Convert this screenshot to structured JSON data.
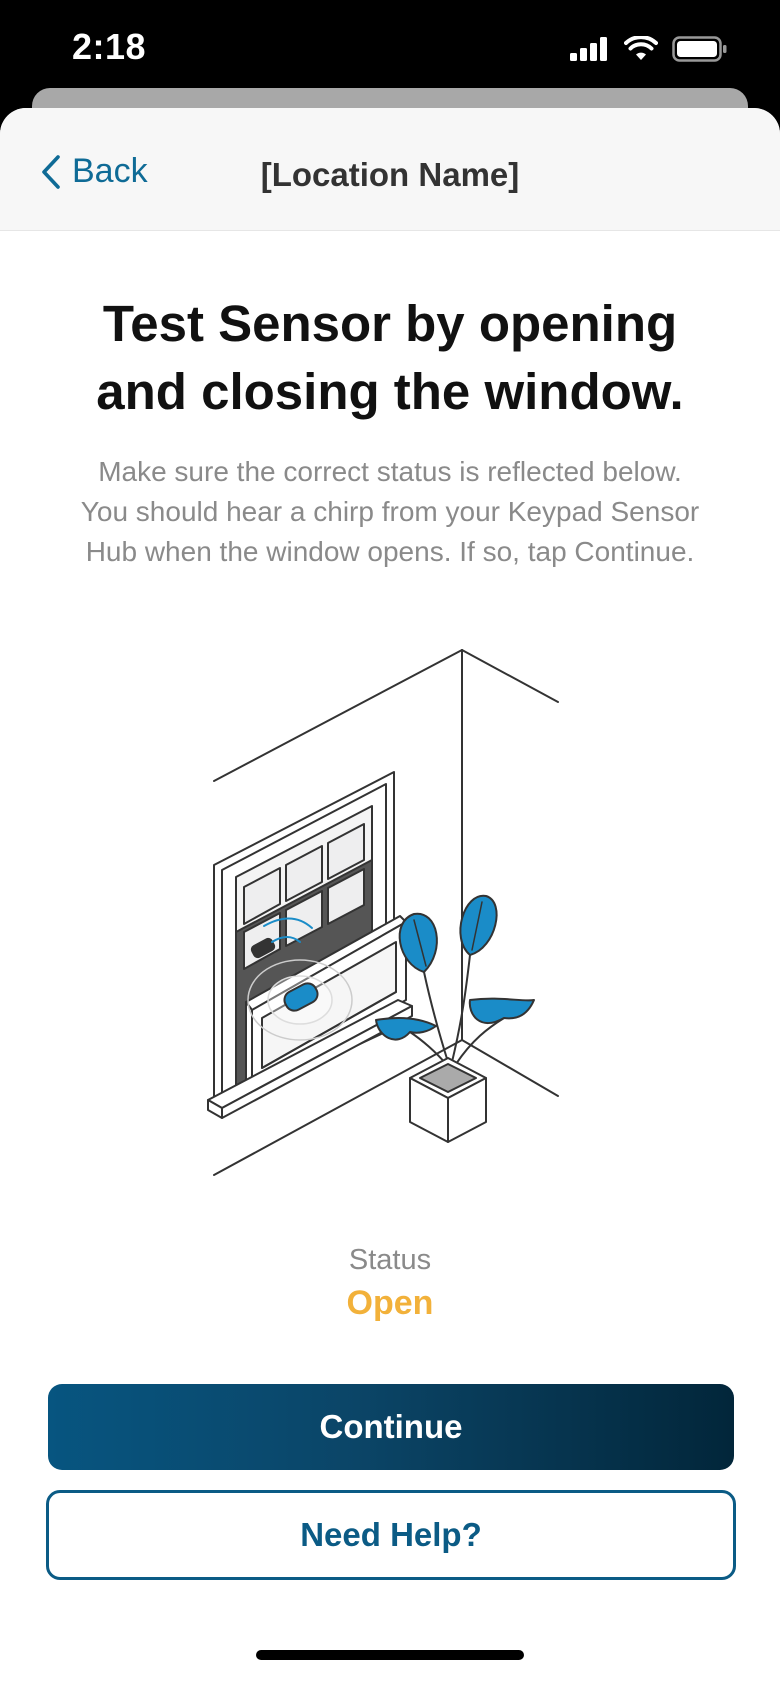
{
  "status_bar": {
    "time": "2:18"
  },
  "nav": {
    "back_label": "Back",
    "title": "[Location Name]"
  },
  "main": {
    "heading_line1": "Test Sensor by opening",
    "heading_line2": "and closing the window.",
    "desc_line1": "Make sure the correct status is reflected below.",
    "desc_line2": "You should hear a chirp from your Keypad Sensor",
    "desc_line3": "Hub when the window opens. If so, tap Continue."
  },
  "status": {
    "label": "Status",
    "value": "Open",
    "value_color": "#f2b13a"
  },
  "buttons": {
    "continue_label": "Continue",
    "help_label": "Need Help?"
  },
  "colors": {
    "accent": "#0f6b96",
    "primary_dark": "#02263a",
    "plant_blue": "#1a8cc8"
  },
  "icons": [
    "signal-icon",
    "wifi-icon",
    "battery-icon",
    "chevron-left-icon"
  ]
}
